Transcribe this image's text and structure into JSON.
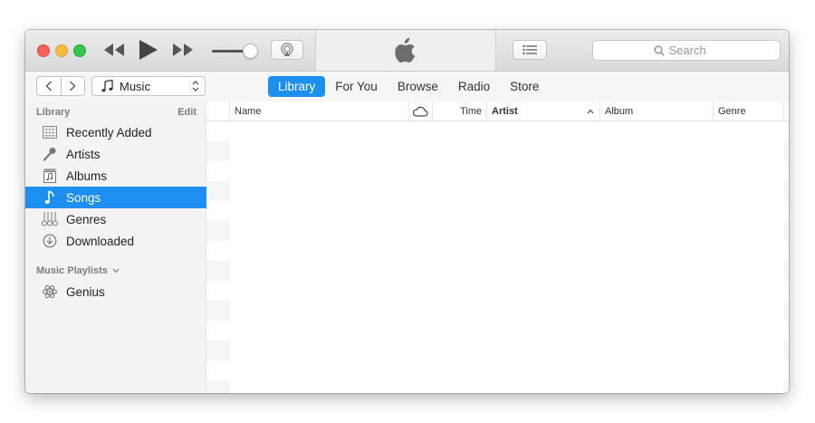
{
  "toolbar": {
    "search_placeholder": "Search",
    "volume_level": 0.7
  },
  "nav": {
    "media_kind": "Music",
    "tabs": [
      {
        "label": "Library",
        "active": true
      },
      {
        "label": "For You",
        "active": false
      },
      {
        "label": "Browse",
        "active": false
      },
      {
        "label": "Radio",
        "active": false
      },
      {
        "label": "Store",
        "active": false
      }
    ]
  },
  "sidebar": {
    "library_heading": "Library",
    "edit_label": "Edit",
    "items": [
      {
        "label": "Recently Added",
        "icon": "grid-icon",
        "selected": false
      },
      {
        "label": "Artists",
        "icon": "microphone-icon",
        "selected": false
      },
      {
        "label": "Albums",
        "icon": "album-icon",
        "selected": false
      },
      {
        "label": "Songs",
        "icon": "music-note-icon",
        "selected": true
      },
      {
        "label": "Genres",
        "icon": "guitar-icon",
        "selected": false
      },
      {
        "label": "Downloaded",
        "icon": "download-icon",
        "selected": false
      }
    ],
    "playlists_heading": "Music Playlists",
    "playlists": [
      {
        "label": "Genius",
        "icon": "atom-icon"
      }
    ]
  },
  "song_list": {
    "columns": {
      "name": "Name",
      "time": "Time",
      "artist": "Artist",
      "album": "Album",
      "genre": "Genre"
    },
    "sort_column": "Artist",
    "sort_direction": "ascending"
  },
  "colors": {
    "accent": "#1d8ff0",
    "traffic_red": "#fc605c",
    "traffic_yellow": "#fdbc40",
    "traffic_green": "#34c84a"
  }
}
